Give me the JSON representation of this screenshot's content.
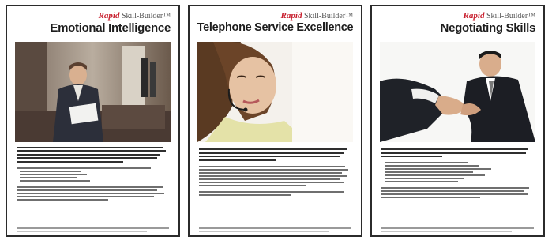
{
  "brand": {
    "script": "Rapid",
    "name": "Skill-Builder",
    "tm": "™"
  },
  "cards": [
    {
      "title": "Emotional Intelligence"
    },
    {
      "title": "Telephone Service Excellence"
    },
    {
      "title": "Negotiating Skills"
    }
  ],
  "colors": {
    "accent": "#c8202f",
    "border": "#2b2b2b",
    "title": "#1d1d1d"
  }
}
